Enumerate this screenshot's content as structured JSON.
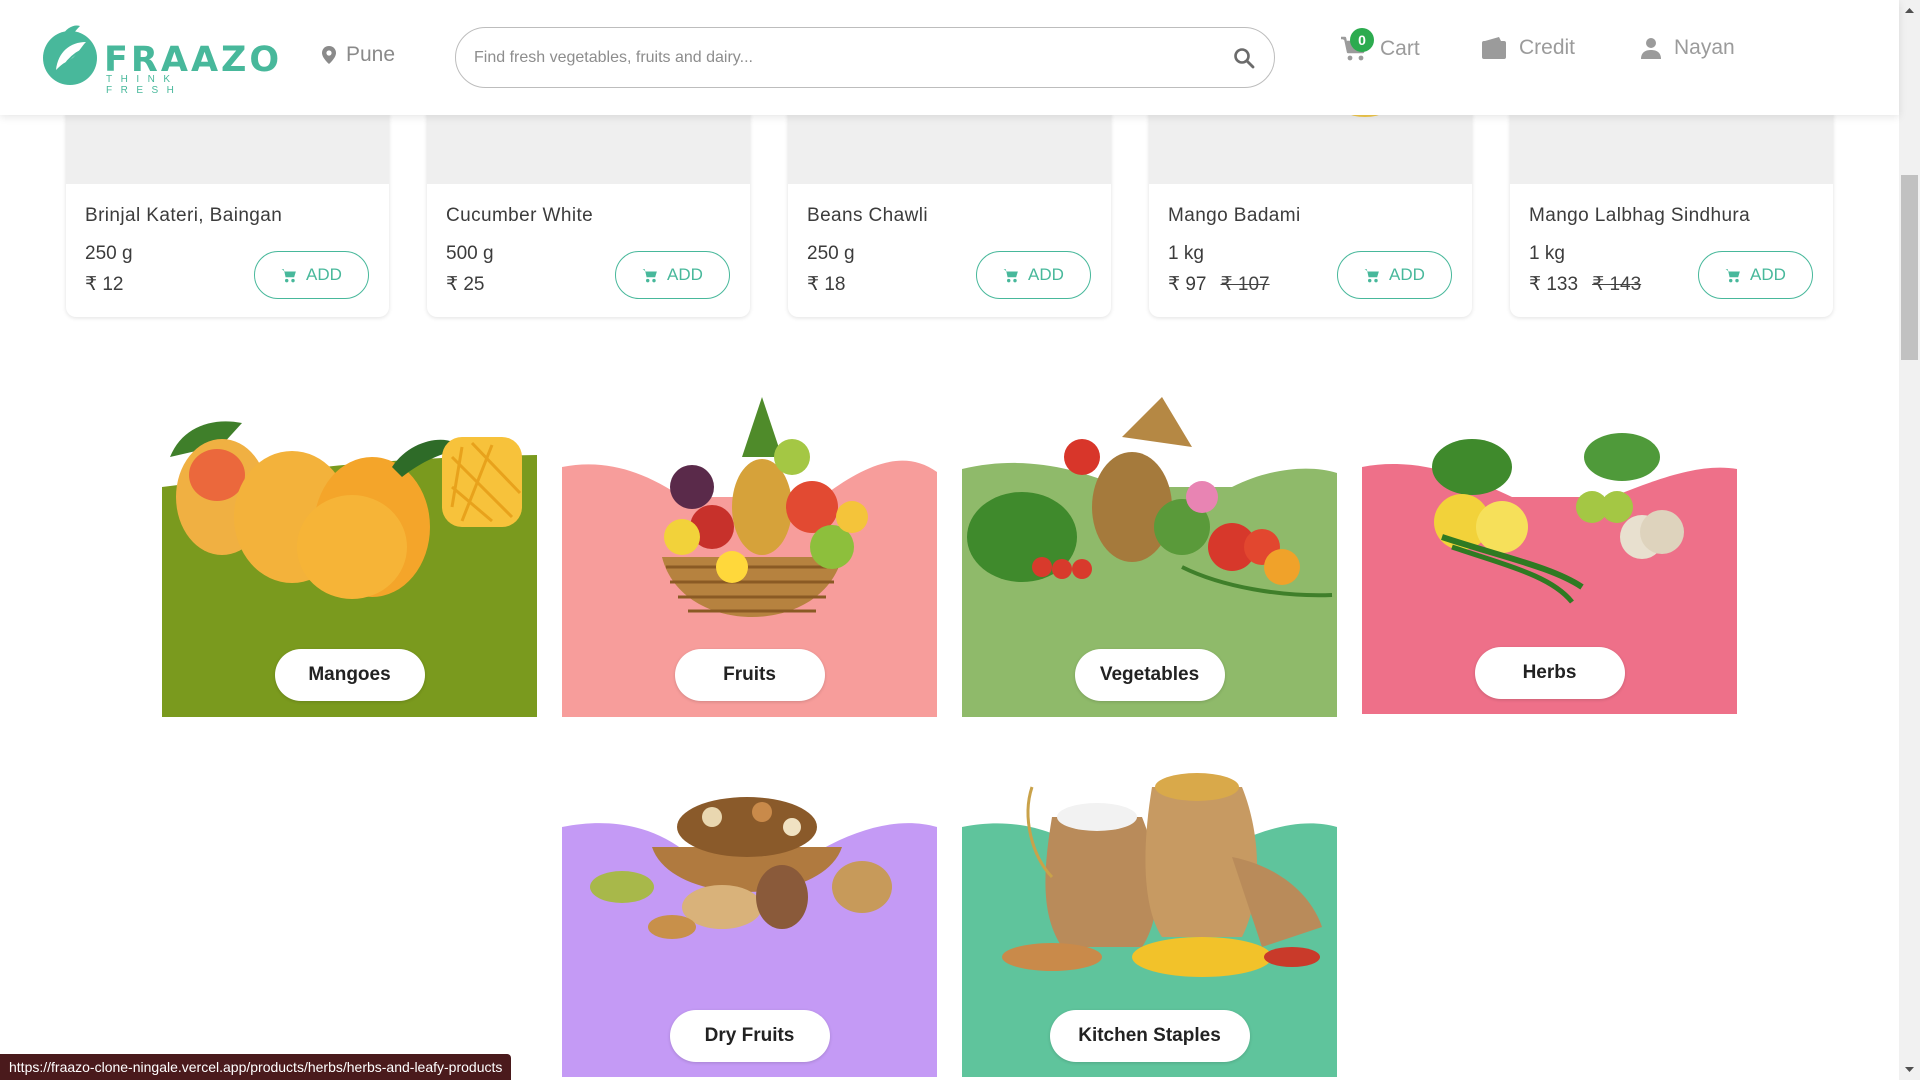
{
  "header": {
    "brand": "FRAAZO",
    "tagline": "THINK FRESH",
    "location": "Pune",
    "search_placeholder": "Find fresh vegetables, fruits and dairy...",
    "cart_count": "0",
    "cart_label": "Cart",
    "credit_label": "Credit",
    "user_label": "Nayan"
  },
  "products": [
    {
      "name": "Brinjal Kateri, Baingan",
      "qty": "250 g",
      "price": "₹ 12",
      "mrp": ""
    },
    {
      "name": "Cucumber White",
      "qty": "500 g",
      "price": "₹ 25",
      "mrp": ""
    },
    {
      "name": "Beans Chawli",
      "qty": "250 g",
      "price": "₹ 18",
      "mrp": ""
    },
    {
      "name": "Mango Badami",
      "qty": "1 kg",
      "price": "₹ 97",
      "mrp": "₹ 107"
    },
    {
      "name": "Mango Lalbhag Sindhura",
      "qty": "1 kg",
      "price": "₹ 133",
      "mrp": "₹ 143"
    }
  ],
  "add_label": "ADD",
  "categories": [
    {
      "label": "Mangoes",
      "color": "#7a9a1e"
    },
    {
      "label": "Fruits",
      "color": "#f79d9b"
    },
    {
      "label": "Vegetables",
      "color": "#8fba6a"
    },
    {
      "label": "Herbs",
      "color": "#ee7089"
    },
    {
      "label": "Dry Fruits",
      "color": "#c49af5"
    },
    {
      "label": "Kitchen Staples",
      "color": "#5fc49c"
    }
  ],
  "status_url": "https://fraazo-clone-ningale.vercel.app/products/herbs/herbs-and-leafy-products",
  "colors": {
    "brand": "#48b89b",
    "badge": "#2cab4f"
  }
}
